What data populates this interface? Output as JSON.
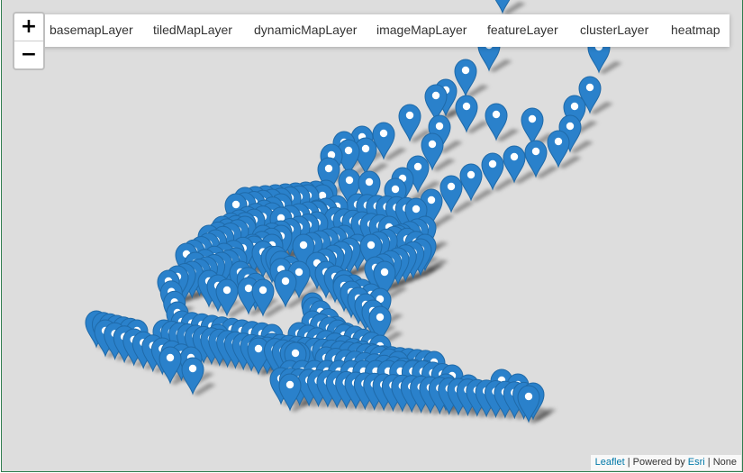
{
  "zoom": {
    "in_label": "+",
    "out_label": "−"
  },
  "layers": [
    "basemapLayer",
    "tiledMapLayer",
    "dynamicMapLayer",
    "imageMapLayer",
    "featureLayer",
    "clusterLayer",
    "heatmap"
  ],
  "attribution": {
    "leaflet": "Leaflet",
    "sep1": " | Powered by ",
    "esri": "Esri",
    "sep2": " | None"
  },
  "colors": {
    "marker": "#2a81cb",
    "marker_dark": "#1f6aa9",
    "map_bg": "#dddddd"
  }
}
